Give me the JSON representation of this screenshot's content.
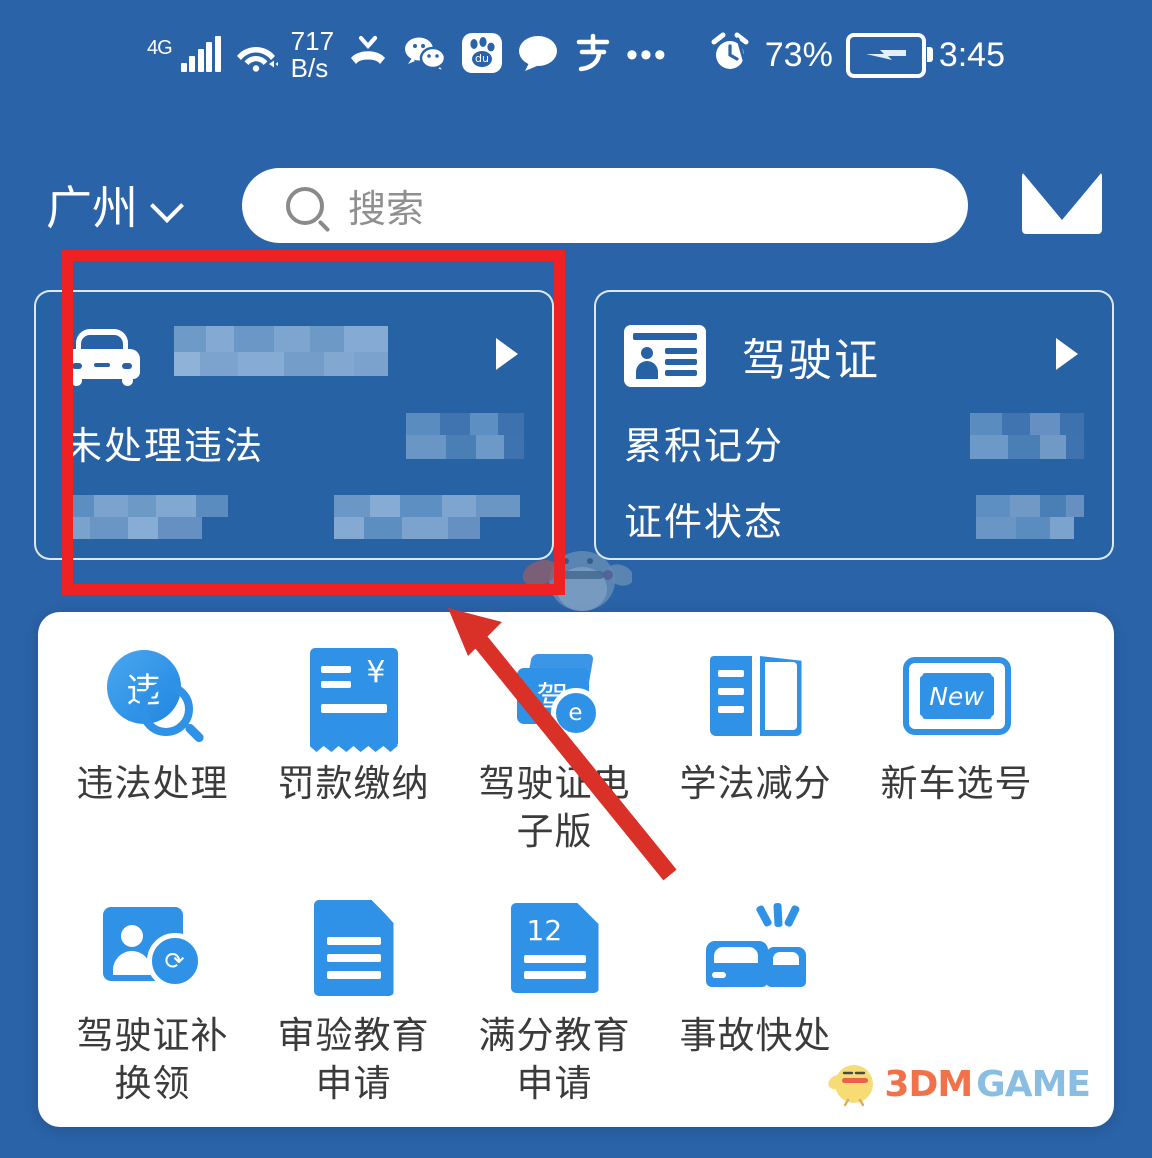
{
  "status_bar": {
    "network_type": "4G",
    "signal_icon": "signal-bars-icon",
    "wifi_icon": "wifi-icon",
    "data_speed": "717",
    "data_speed_unit": "B/s",
    "missed_call_icon": "missed-call-icon",
    "wechat_icon": "wechat-icon",
    "baidu_icon": "baidu-icon",
    "message_icon": "message-bubble-icon",
    "alipay_icon": "alipay-icon",
    "overflow_icon": "more-dots-icon",
    "alarm_icon": "alarm-clock-icon",
    "battery_percent": "73%",
    "battery_icon": "battery-charging-icon",
    "time": "3:45"
  },
  "header": {
    "city": "广州",
    "city_chevron_icon": "chevron-down-icon",
    "search_icon": "search-icon",
    "search_placeholder": "搜索",
    "search_value": "",
    "mail_icon": "envelope-icon"
  },
  "cards": {
    "vehicle": {
      "icon": "car-icon",
      "title_masked": true,
      "arrow_icon": "play-triangle-icon",
      "row_label": "未处理违法",
      "row_value_masked": true,
      "footer_left_masked": true,
      "footer_right_masked": true
    },
    "license": {
      "icon": "id-card-icon",
      "title": "驾驶证",
      "arrow_icon": "play-triangle-icon",
      "rows": [
        {
          "label": "累积记分",
          "value_masked": true
        },
        {
          "label": "证件状态",
          "value_masked": true
        }
      ]
    }
  },
  "apps": {
    "row1": [
      {
        "label": "违法处理",
        "icon": "violation-search-icon",
        "glyph": "违"
      },
      {
        "label": "罚款缴纳",
        "icon": "receipt-yen-icon",
        "glyph": "¥"
      },
      {
        "label": "驾驶证电\n子版",
        "icon": "driver-license-electronic-icon",
        "glyph": "驾",
        "badge": "e"
      },
      {
        "label": "学法减分",
        "icon": "open-book-icon"
      },
      {
        "label": "新车选号",
        "icon": "license-plate-new-icon",
        "glyph": "New"
      }
    ],
    "row2": [
      {
        "label": "驾驶证补\n换领",
        "icon": "license-renew-icon",
        "badge": "⟳"
      },
      {
        "label": "审验教育\n申请",
        "icon": "document-lines-icon"
      },
      {
        "label": "满分教育\n申请",
        "icon": "document-12-points-icon",
        "glyph": "12"
      },
      {
        "label": "事故快处",
        "icon": "accident-quick-handle-icon"
      }
    ]
  },
  "annotations": {
    "highlight_rect_color": "#ee2222",
    "arrow_color": "#d93028",
    "arrow_icon": "pointer-arrow-icon",
    "highlight_target": "未处理违法"
  },
  "watermark": {
    "mascot_icon": "bird-mascot-icon",
    "brand_part1": "3DM",
    "brand_part2": "GAME",
    "brand_color1": "#f0663c",
    "brand_color2": "#7fb8e0"
  },
  "theme": {
    "background_blue": "#2b63a8",
    "card_blue": "#2762a5",
    "panel_white": "#ffffff",
    "icon_blue": "#2f92e6",
    "caption_gray": "#3b3b3b"
  }
}
